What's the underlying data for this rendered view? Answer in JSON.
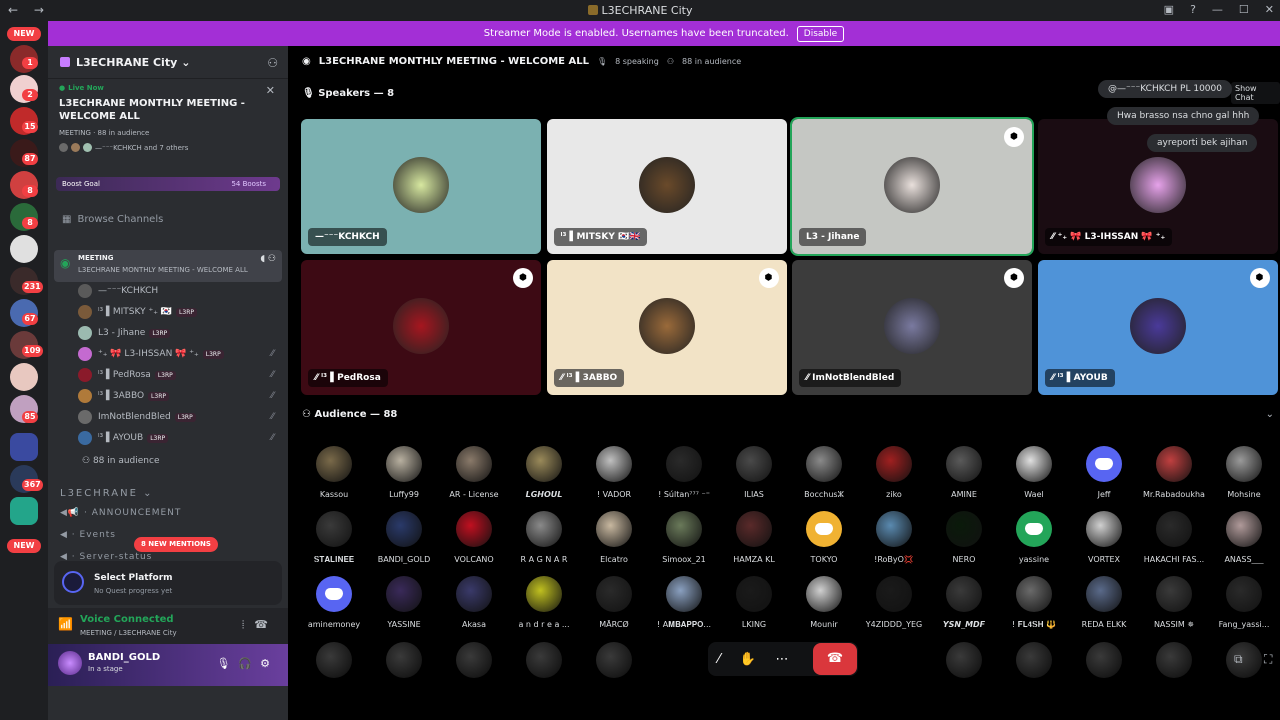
{
  "window": {
    "title": "L3ECHRANE City",
    "nav": "← →"
  },
  "banner": {
    "text": "Streamer Mode is enabled. Usernames have been truncated.",
    "button": "Disable"
  },
  "servers": {
    "new_top": "NEW",
    "new_bottom": "NEW",
    "badges": [
      "1",
      "2",
      "15",
      "87",
      "8",
      "8",
      "231",
      "67",
      "109",
      "85",
      "367"
    ]
  },
  "sidebar": {
    "server_name": "L3ECHRANE City",
    "live": {
      "label": "Live Now",
      "title": "L3ECHRANE MONTHLY MEETING - WELCOME ALL",
      "meta": "MEETING · 88 in audience",
      "users": "—⁻⁻⁻KCHKCH and 7 others"
    },
    "boost": {
      "label": "Boost Goal",
      "count": "54 Boosts"
    },
    "browse": "Browse Channels",
    "channel": {
      "name": "MEETING",
      "topic": "L3ECHRANE MONTHLY MEETING - WELCOME ALL"
    },
    "members": [
      {
        "name": "—⁻⁻⁻KCHKCH",
        "tag": "",
        "color": "#5a5a5a"
      },
      {
        "name": "ˡ³ ▌MITSKY ⁺₊ 🇰🇷",
        "tag": "L3RP",
        "color": "#7a5a3a"
      },
      {
        "name": "L3 - Jihane",
        "tag": "L3RP",
        "color": "#9bbab0"
      },
      {
        "name": "⁺₊ 🎀 L3-IHSSAN 🎀 ⁺₊",
        "tag": "L3RP",
        "color": "#c46ad0"
      },
      {
        "name": "ˡ³ ▌PedRosa",
        "tag": "L3RP",
        "color": "#8a1a2a"
      },
      {
        "name": "ˡ³ ▌3ABBO",
        "tag": "L3RP",
        "color": "#b07a3a"
      },
      {
        "name": "ImNotBlendBled",
        "tag": "L3RP",
        "color": "#6a6a6a"
      },
      {
        "name": "ˡ³ ▌AYOUB",
        "tag": "L3RP",
        "color": "#3a6aa0"
      }
    ],
    "audience_count": "88 in audience",
    "category": "L3ECHRANE",
    "channels": [
      "· ANNOUNCEMENT",
      "· Events",
      "· Server-status"
    ],
    "mentions": "8 NEW MENTIONS",
    "platform": {
      "title": "Select Platform",
      "subtitle": "No Quest progress yet"
    },
    "voice": {
      "status": "Voice Connected",
      "location": "MEETING / L3ECHRANE City"
    },
    "user": {
      "name": "BANDI_GOLD",
      "status": "In a stage"
    }
  },
  "stage": {
    "title": "L3ECHRANE MONTHLY MEETING - WELCOME ALL",
    "speaking": "8 speaking",
    "audience": "88 in audience",
    "show_chat": "Show Chat",
    "speakers_header": "Speakers — 8",
    "audience_header": "Audience — 88",
    "speakers": [
      {
        "name": "—⁻⁻⁻KCHKCH",
        "bg": "#7bb1b1",
        "av": "#d7e8a0",
        "shield": false,
        "light": false
      },
      {
        "name": "ˡ³ ▌MITSKY 🇰🇷🇬🇧",
        "bg": "#e8e8e8",
        "av": "#6a4a2a",
        "shield": false,
        "light": true
      },
      {
        "name": "L3 - Jihane",
        "bg": "#c5c7c3",
        "av": "#e9e0dc",
        "shield": true,
        "light": true
      },
      {
        "name": "⁄⁄ ⁺₊ 🎀 L3-IHSSAN 🎀 ⁺₊",
        "bg": "#1a0c12",
        "av": "#e6a2ea",
        "shield": false,
        "light": false
      },
      {
        "name": "⁄⁄ ˡ³ ▌PedRosa",
        "bg": "#3d0a14",
        "av": "#a6161f",
        "shield": true,
        "light": false
      },
      {
        "name": "⁄⁄ ˡ³ ▌3ABBO",
        "bg": "#f2e3c6",
        "av": "#9a6a3a",
        "shield": true,
        "light": true
      },
      {
        "name": "⁄⁄ ImNotBlendBled",
        "bg": "#3c3c3c",
        "av": "#7a7aa0",
        "shield": true,
        "light": false
      },
      {
        "name": "⁄⁄ ˡ³ ▌AYOUB",
        "bg": "#4f93d8",
        "av": "#4a3a9a",
        "shield": true,
        "light": false
      }
    ],
    "chat_bubbles": [
      "@—⁻⁻⁻KCHKCH PL 10000",
      "Hwa brasso nsa chno gal hhh",
      "ayreporti bek ajihan"
    ],
    "audience_members": [
      {
        "name": "Kassou",
        "color": "#7a6a4a"
      },
      {
        "name": "Luffy99",
        "color": "#b8b0a0"
      },
      {
        "name": "AR - License",
        "color": "#8a7a6a"
      },
      {
        "name": "𝙇𝙂𝙃𝙊𝙐𝙇",
        "color": "#9a8a5a"
      },
      {
        "name": "! VADOR",
        "color": "#c0c0c0"
      },
      {
        "name": "! Súltan⁷⁷⁷ ⁻⁼",
        "color": "#2a2a2a"
      },
      {
        "name": "ILIAS",
        "color": "#4a4a4a"
      },
      {
        "name": "Bocchusⵣ",
        "color": "#8a8a8a"
      },
      {
        "name": "ziko",
        "color": "#a02020"
      },
      {
        "name": "AMINE",
        "color": "#5a5a5a"
      },
      {
        "name": "Wael",
        "color": "#e0e0e0"
      },
      {
        "name": "Jeff",
        "color": "discord"
      },
      {
        "name": "Mr.Rabadoukha",
        "color": "#c04040"
      },
      {
        "name": "Mohsine",
        "color": "#9a9a9a"
      },
      {
        "name": "𝐒𝐓𝐀𝐋𝐈𝐍𝐄𝐄",
        "color": "#3a3a3a"
      },
      {
        "name": "BANDI_GOLD",
        "color": "#2a3a6a"
      },
      {
        "name": "VOLCANO",
        "color": "#c01020"
      },
      {
        "name": "R A G N A R",
        "color": "#8a8a8a"
      },
      {
        "name": "Elcatro",
        "color": "#c8b8a0"
      },
      {
        "name": "Simoox_21",
        "color": "#6a7a5a"
      },
      {
        "name": "HAMZA KL",
        "color": "#5a2a2a"
      },
      {
        "name": "TOKYO",
        "color": "discord-orange"
      },
      {
        "name": "!RoByO💢",
        "color": "#5a8ab0"
      },
      {
        "name": "NERO",
        "color": "#0a1a0a"
      },
      {
        "name": "yassine",
        "color": "discord-green"
      },
      {
        "name": "VORTEX",
        "color": "#d0d0d0"
      },
      {
        "name": "HAKACHI FAS...",
        "color": "#2a2a2a"
      },
      {
        "name": "ANASS___",
        "color": "#b09a9a"
      },
      {
        "name": "aminemoney",
        "color": "discord"
      },
      {
        "name": "YASSINE",
        "color": "#3a2a5a"
      },
      {
        "name": "Akasa",
        "color": "#3a3a6a"
      },
      {
        "name": "a n d r e a ...",
        "color": "#c0c020"
      },
      {
        "name": "MĀRCØ",
        "color": "#2a2a2a"
      },
      {
        "name": "! A𝐌𝐁𝐀𝐏𝐏𝐎...",
        "color": "#8aa0c0"
      },
      {
        "name": "LKING",
        "color": "#1a1a1a"
      },
      {
        "name": "Mounir",
        "color": "#d0d0d0"
      },
      {
        "name": "Y4ZIDDD_YEG",
        "color": "#1a1a1a"
      },
      {
        "name": "𝙔𝙎𝙉_𝙈𝘿𝙁",
        "color": "#3a3a3a"
      },
      {
        "name": "! 𝐅𝐋𝟒𝐒𝐇 🔱",
        "color": "#6a6a6a"
      },
      {
        "name": "REDA ELKK",
        "color": "#5a6a8a"
      },
      {
        "name": "NASSIM ✵",
        "color": "#3a3a3a"
      },
      {
        "name": "Fang_yassi...",
        "color": "#2a2a2a"
      }
    ],
    "controls": {
      "mute": "mute-off",
      "hand": "raise-hand",
      "more": "more",
      "leave": "leave"
    }
  }
}
